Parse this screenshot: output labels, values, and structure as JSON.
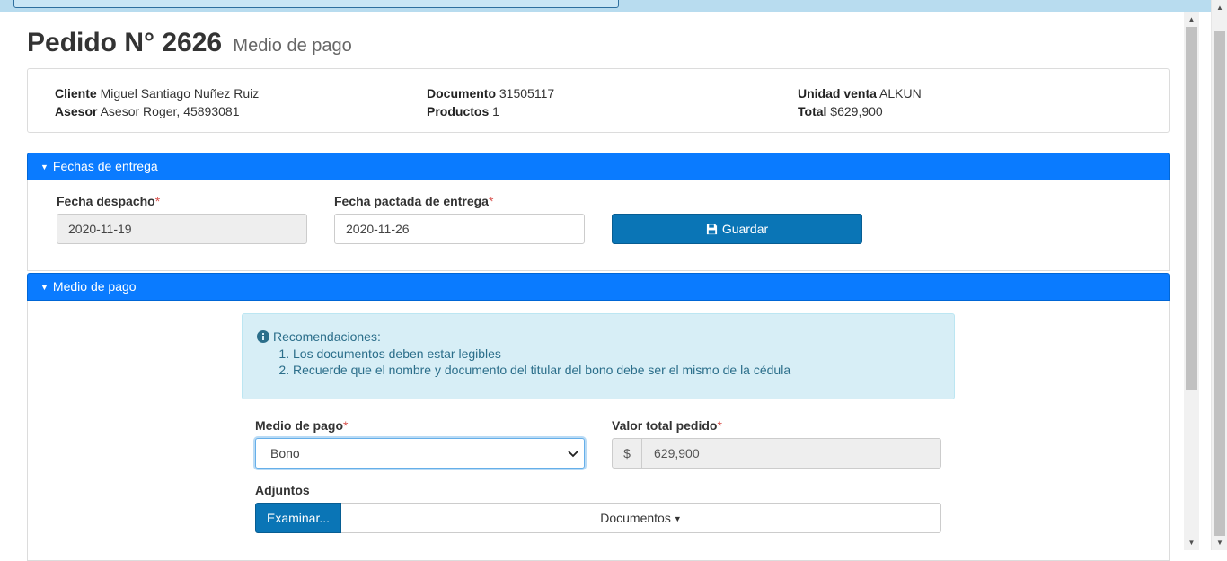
{
  "header": {
    "title": "Pedido N° 2626",
    "subtitle": "Medio de pago"
  },
  "summary": {
    "cliente_label": "Cliente",
    "cliente_value": "Miguel Santiago Nuñez Ruiz",
    "asesor_label": "Asesor",
    "asesor_value": "Asesor Roger, 45893081",
    "documento_label": "Documento",
    "documento_value": "31505117",
    "productos_label": "Productos",
    "productos_value": "1",
    "unidad_label": "Unidad venta",
    "unidad_value": "ALKUN",
    "total_label": "Total",
    "total_value": "$629,900"
  },
  "entrega": {
    "title": "Fechas de entrega",
    "despacho_label": "Fecha despacho",
    "despacho_value": "2020-11-19",
    "pactada_label": "Fecha pactada de entrega",
    "pactada_value": "2020-11-26",
    "required_mark": "*",
    "save_label": "Guardar"
  },
  "pago": {
    "title": "Medio de pago",
    "alert_title": "Recomendaciones:",
    "recommendations": [
      "Los documentos deben estar legibles",
      "Recuerde que el nombre y documento del titular del bono debe ser el mismo de la cédula"
    ],
    "medio_label": "Medio de pago",
    "medio_value": "Bono",
    "valor_label": "Valor total pedido",
    "currency_symbol": "$",
    "valor_value": "629,900",
    "adjuntos_label": "Adjuntos",
    "browse_label": "Examinar...",
    "documentos_label": "Documentos"
  },
  "icons": {
    "caret": "caret-down-icon",
    "save": "floppy-disk-icon",
    "info": "info-circle-icon",
    "select_arrow": "chevron-down-icon"
  },
  "colors": {
    "panel_header": "#0a7bff",
    "primary_button": "#0a75b6",
    "alert_bg": "#d7eef6",
    "alert_text": "#2b6e8a",
    "required": "#d9534f"
  }
}
